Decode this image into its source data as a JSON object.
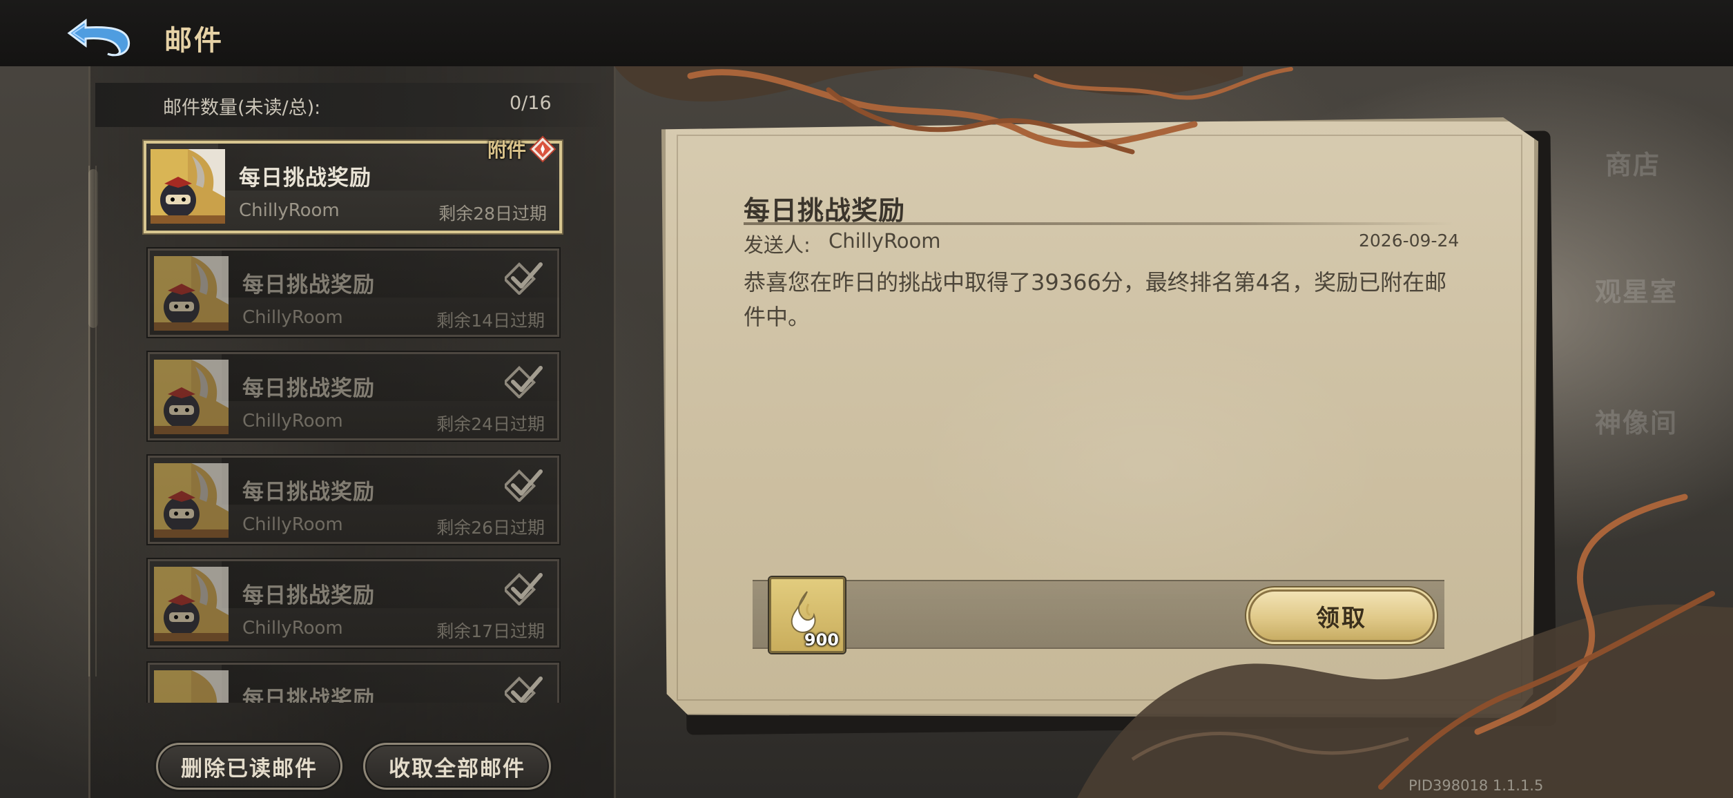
{
  "header": {
    "title": "邮件",
    "back_icon": "back-arrow-icon"
  },
  "mail_list": {
    "count_label": "邮件数量(未读/总):",
    "count_value": "0/16",
    "attachment_tag": "附件",
    "items": [
      {
        "title": "每日挑战奖励",
        "sender": "ChillyRoom",
        "expiry": "剩余28日过期",
        "status": "attachment"
      },
      {
        "title": "每日挑战奖励",
        "sender": "ChillyRoom",
        "expiry": "剩余14日过期",
        "status": "read"
      },
      {
        "title": "每日挑战奖励",
        "sender": "ChillyRoom",
        "expiry": "剩余24日过期",
        "status": "read"
      },
      {
        "title": "每日挑战奖励",
        "sender": "ChillyRoom",
        "expiry": "剩余26日过期",
        "status": "read"
      },
      {
        "title": "每日挑战奖励",
        "sender": "ChillyRoom",
        "expiry": "剩余17日过期",
        "status": "read"
      },
      {
        "title": "每日挑战奖励",
        "sender": "",
        "expiry": "",
        "status": "read"
      }
    ]
  },
  "buttons": {
    "delete_read": "删除已读邮件",
    "collect_all": "收取全部邮件"
  },
  "letter": {
    "title": "每日挑战奖励",
    "sender_label": "发送人:",
    "sender_name": "ChillyRoom",
    "date": "2026-09-24",
    "body": "恭喜您在昨日的挑战中取得了39366分，最终排名第4名，奖励已附在邮件中。",
    "reward": {
      "icon": "spirit-flame-icon",
      "quantity": "900"
    },
    "claim_label": "领取"
  },
  "background_labels": [
    "商店",
    "观星室",
    "神像间"
  ],
  "footer": {
    "version": "PID398018  1.1.1.5"
  },
  "colors": {
    "accent_gold": "#d8c690",
    "title_gold": "#e6d2a6",
    "parchment": "#d7cbb0"
  }
}
